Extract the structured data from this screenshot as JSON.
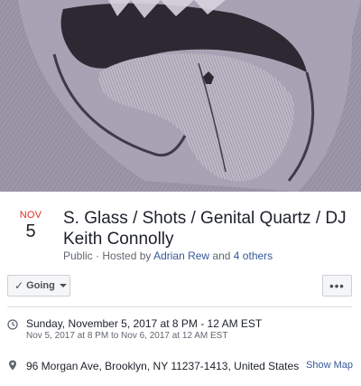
{
  "event": {
    "date_month": "NOV",
    "date_day": "5",
    "title": "S. Glass / Shots / Genital Quartz / DJ Keith Connolly",
    "privacy": "Public",
    "hosted_by_prefix": " · Hosted by ",
    "host_name": "Adrian Rew",
    "host_and": " and ",
    "host_others": "4 others"
  },
  "actions": {
    "going_label": "Going",
    "more_label": "•••"
  },
  "details": {
    "time_main": "Sunday, November 5, 2017 at 8 PM - 12 AM EST",
    "time_sub": "Nov 5, 2017 at 8 PM to Nov 6, 2017 at 12 AM EST",
    "location": "96 Morgan Ave, Brooklyn, NY 11237-1413, United States",
    "show_map_label": "Show Map"
  },
  "icons": {
    "check": "check-icon",
    "caret": "caret-down-icon",
    "clock": "clock-icon",
    "pin": "map-pin-icon"
  },
  "colors": {
    "month_red": "#e02a20",
    "link_blue": "#385898",
    "muted_text": "#606770",
    "cover_bg": "#8f8a9a"
  }
}
